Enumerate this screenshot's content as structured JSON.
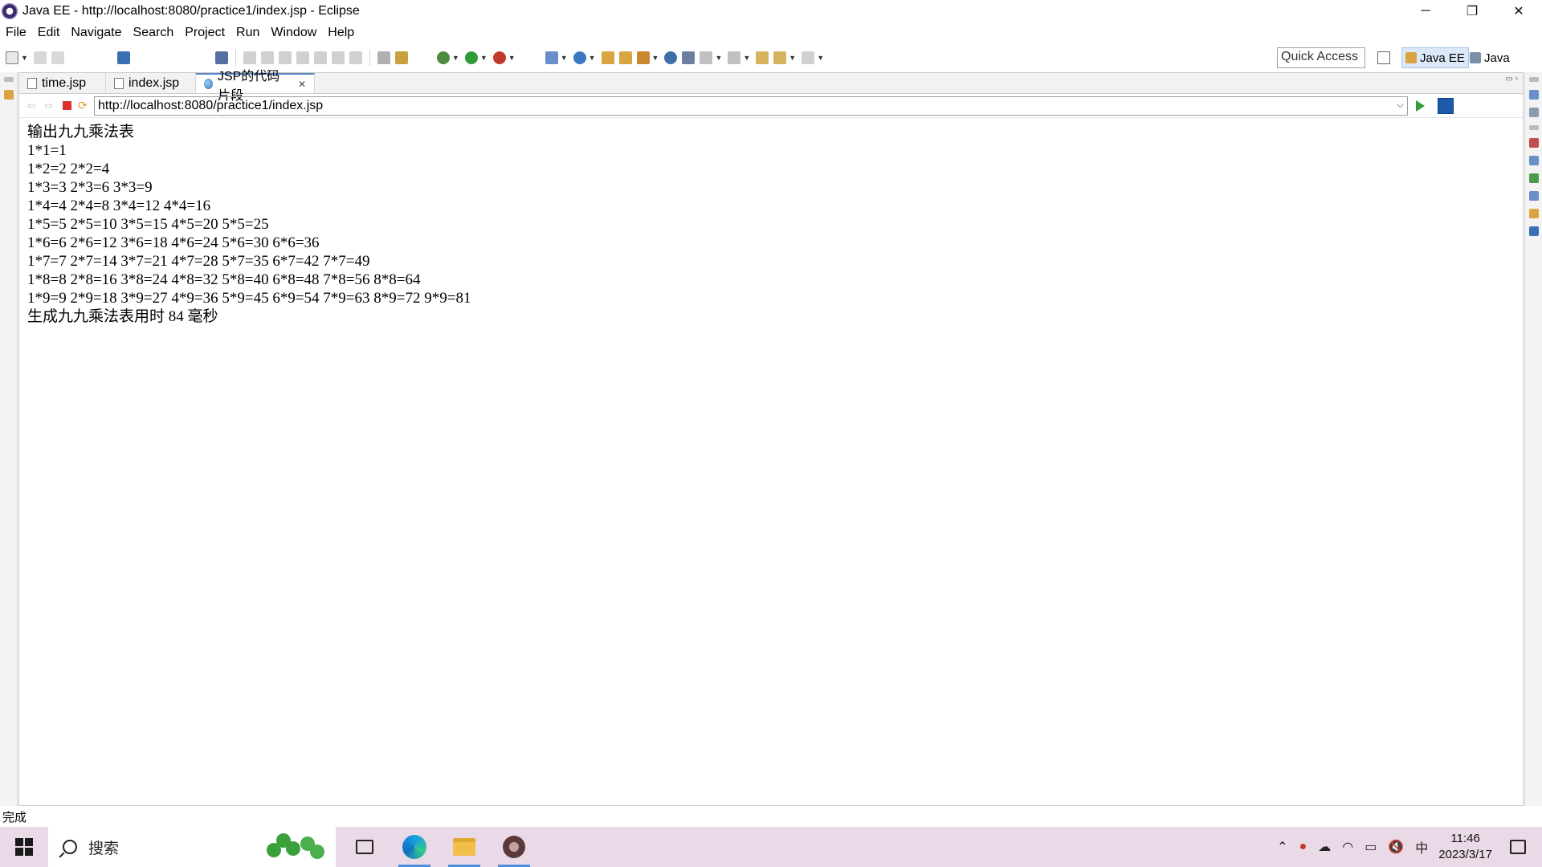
{
  "window": {
    "title": "Java EE - http://localhost:8080/practice1/index.jsp - Eclipse",
    "minimize": "─",
    "restore": "❐",
    "close": "✕"
  },
  "menu": [
    "File",
    "Edit",
    "Navigate",
    "Search",
    "Project",
    "Run",
    "Window",
    "Help"
  ],
  "toolbar": {
    "quick_access": "Quick Access",
    "perspectives": [
      {
        "label": "Java EE",
        "active": true
      },
      {
        "label": "Java",
        "active": false
      }
    ]
  },
  "tabs": [
    {
      "label": "time.jsp",
      "active": false
    },
    {
      "label": "index.jsp",
      "active": false
    },
    {
      "label": "JSP的代码片段",
      "active": true
    }
  ],
  "browser": {
    "url": "http://localhost:8080/practice1/index.jsp"
  },
  "page": {
    "heading": "输出九九乘法表",
    "lines": [
      "1*1=1",
      "1*2=2 2*2=4",
      "1*3=3 2*3=6 3*3=9",
      "1*4=4 2*4=8 3*4=12 4*4=16",
      "1*5=5 2*5=10 3*5=15 4*5=20 5*5=25",
      "1*6=6 2*6=12 3*6=18 4*6=24 5*6=30 6*6=36",
      "1*7=7 2*7=14 3*7=21 4*7=28 5*7=35 6*7=42 7*7=49",
      "1*8=8 2*8=16 3*8=24 4*8=32 5*8=40 6*8=48 7*8=56 8*8=64",
      "1*9=9 2*9=18 3*9=27 4*9=36 5*9=45 6*9=54 7*9=63 8*9=72 9*9=81"
    ],
    "footer": "生成九九乘法表用时 84 毫秒"
  },
  "status": "完成",
  "taskbar": {
    "search_label": "搜索",
    "ime": "中",
    "time": "11:46",
    "date": "2023/3/17"
  },
  "colors": {
    "accent": "#5a86c6",
    "taskbar_bg": "#ead9e6"
  }
}
